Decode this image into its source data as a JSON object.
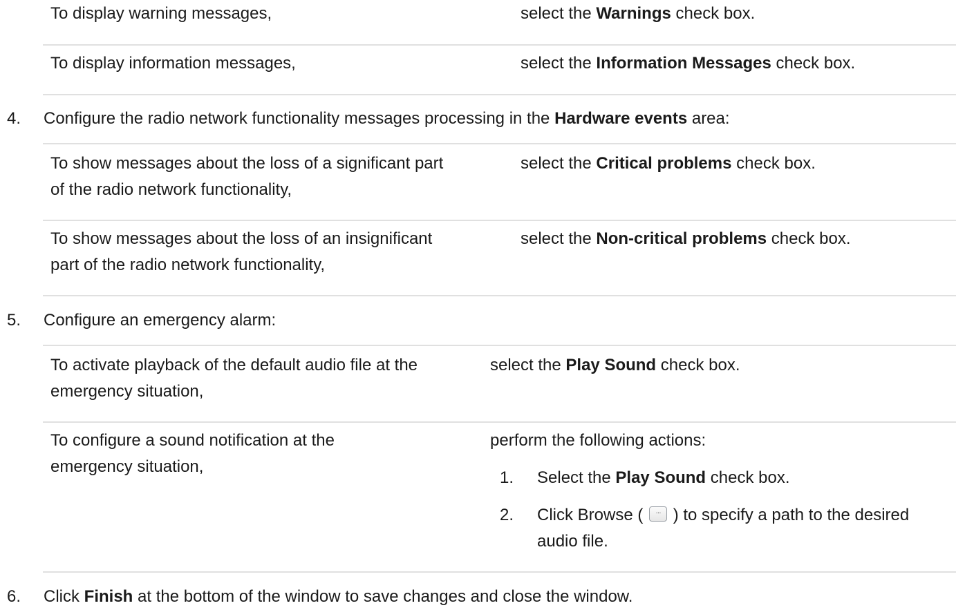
{
  "table_warnings": {
    "rows": [
      {
        "left": "To display warning messages,",
        "right_pre": "select the ",
        "right_bold": "Warnings",
        "right_post": " check box."
      },
      {
        "left": "To display information messages,",
        "right_pre": "select the ",
        "right_bold": "Information Messages",
        "right_post": " check box."
      }
    ]
  },
  "step4": {
    "number": "4.",
    "text_pre": "Configure the radio network functionality messages processing in the ",
    "text_bold": "Hardware events",
    "text_post": " area:"
  },
  "table_hardware": {
    "rows": [
      {
        "left_line1": "To show messages about the loss of a significant part",
        "left_line2": "of the radio network functionality,",
        "right_pre": "select the ",
        "right_bold": "Critical problems",
        "right_post": " check box."
      },
      {
        "left_line1": "To show messages about the loss of an insignificant",
        "left_line2": "part of the radio network functionality,",
        "right_pre": "select the ",
        "right_bold": "Non-critical problems",
        "right_post": " check box."
      }
    ]
  },
  "step5": {
    "number": "5.",
    "text": "Configure an emergency alarm:"
  },
  "table_alarm": {
    "rows": [
      {
        "left_line1": "To activate playback of the default audio file at the",
        "left_line2": "emergency situation,",
        "right_pre": "select the ",
        "right_bold": "Play Sound",
        "right_post": " check box."
      },
      {
        "left_line1": "To configure a sound notification at the",
        "left_line2": "emergency situation,",
        "right_intro": "perform the following actions:"
      }
    ],
    "sub_steps": [
      {
        "number": "1.",
        "text_pre": "Select the ",
        "text_bold": "Play Sound",
        "text_post": " check box."
      },
      {
        "number": "2.",
        "text_pre": "Click Browse (",
        "icon": "browse-button-icon",
        "text_mid": ") to specify a path to the desired",
        "text_line2": "audio file."
      }
    ]
  },
  "step6": {
    "number": "6.",
    "text_pre": "Click ",
    "text_bold": "Finish",
    "text_post": " at the bottom of the window to save changes and close the window."
  }
}
